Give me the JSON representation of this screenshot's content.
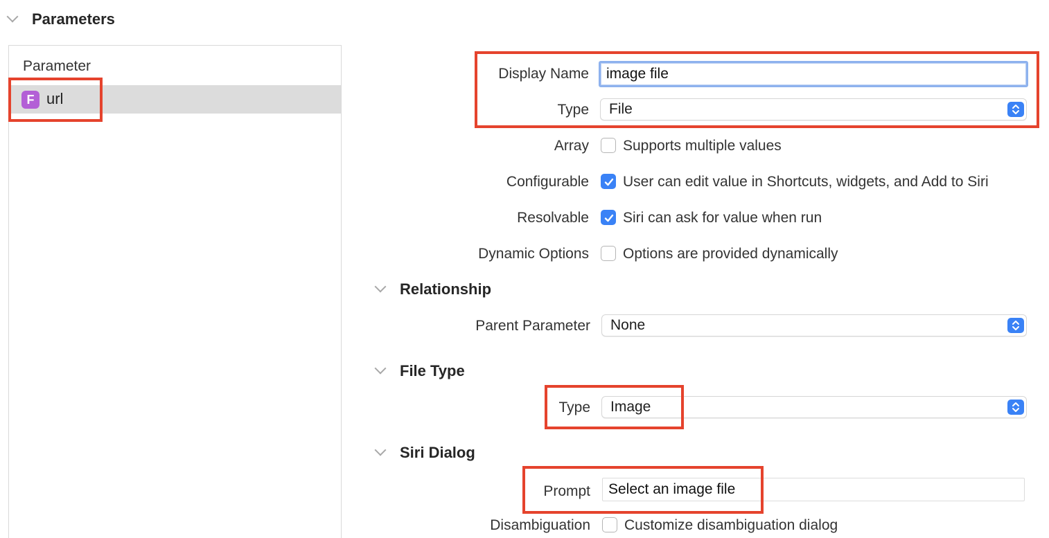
{
  "parameters_section": {
    "title": "Parameters"
  },
  "parameter_list": {
    "column_header": "Parameter",
    "items": [
      {
        "badge": "F",
        "name": "url",
        "badge_color": "#b35fd6"
      }
    ]
  },
  "fields": {
    "display_name": {
      "label": "Display Name",
      "value": "image file"
    },
    "type": {
      "label": "Type",
      "value": "File"
    },
    "array": {
      "label": "Array",
      "checkbox_label": "Supports multiple values",
      "checked": false
    },
    "configurable": {
      "label": "Configurable",
      "checkbox_label": "User can edit value in Shortcuts, widgets, and Add to Siri",
      "checked": true
    },
    "resolvable": {
      "label": "Resolvable",
      "checkbox_label": "Siri can ask for value when run",
      "checked": true
    },
    "dynamic_options": {
      "label": "Dynamic Options",
      "checkbox_label": "Options are provided dynamically",
      "checked": false
    }
  },
  "relationship": {
    "title": "Relationship",
    "parent_parameter": {
      "label": "Parent Parameter",
      "value": "None"
    }
  },
  "file_type": {
    "title": "File Type",
    "type": {
      "label": "Type",
      "value": "Image"
    }
  },
  "siri_dialog": {
    "title": "Siri Dialog",
    "prompt": {
      "label": "Prompt",
      "value": "Select an image file"
    },
    "disambiguation": {
      "label": "Disambiguation",
      "checkbox_label": "Customize disambiguation dialog",
      "checked": false
    }
  },
  "colors": {
    "accent": "#3a82f6",
    "highlight": "#e5432d",
    "selection": "#dcdcdc"
  }
}
